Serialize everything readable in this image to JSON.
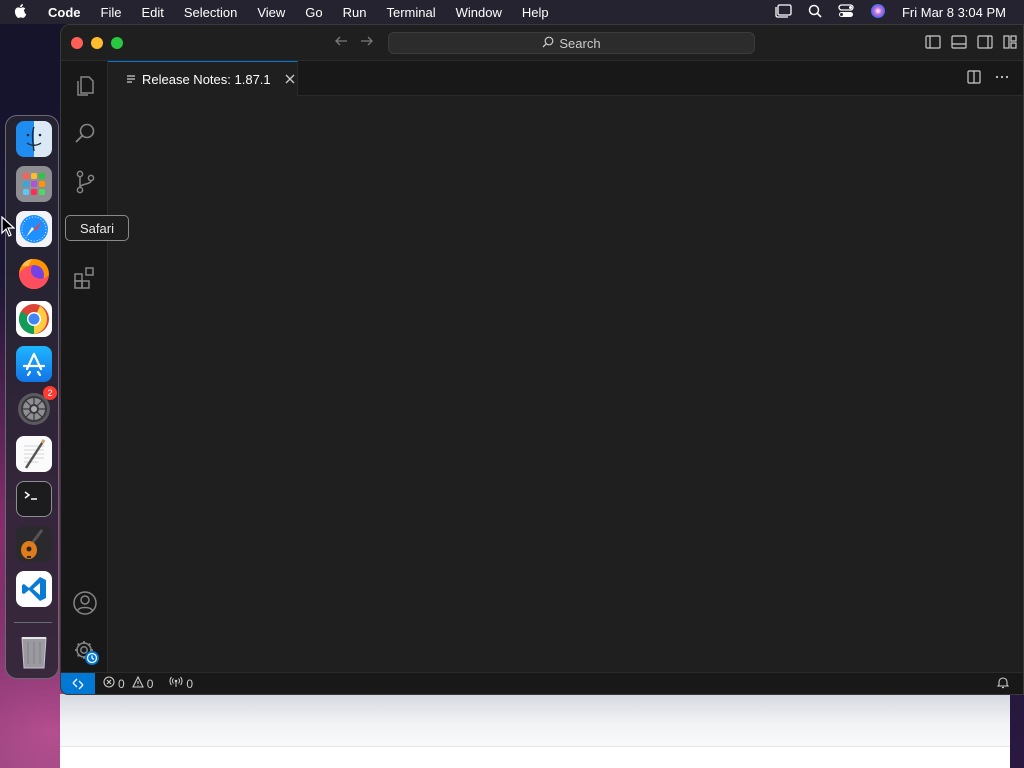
{
  "menubar": {
    "app_name": "Code",
    "items": [
      "File",
      "Edit",
      "Selection",
      "View",
      "Go",
      "Run",
      "Terminal",
      "Window",
      "Help"
    ],
    "clock": "Fri Mar 8  3:04 PM"
  },
  "window": {
    "search_label": "Search",
    "tab_title": "Release Notes: 1.87.1"
  },
  "statusbar": {
    "errors": "0",
    "warnings": "0",
    "ports": "0"
  },
  "dock": {
    "tooltip": "Safari",
    "apps": [
      "Finder",
      "Launchpad",
      "Safari",
      "Firefox",
      "Google Chrome",
      "App Store",
      "System Settings",
      "TextEdit",
      "Terminal",
      "GarageBand",
      "Visual Studio Code",
      "Trash"
    ],
    "settings_badge": "2"
  },
  "colors": {
    "accent": "#0078d4",
    "editor_bg": "#1f1f1f",
    "sidebar_bg": "#181818"
  }
}
